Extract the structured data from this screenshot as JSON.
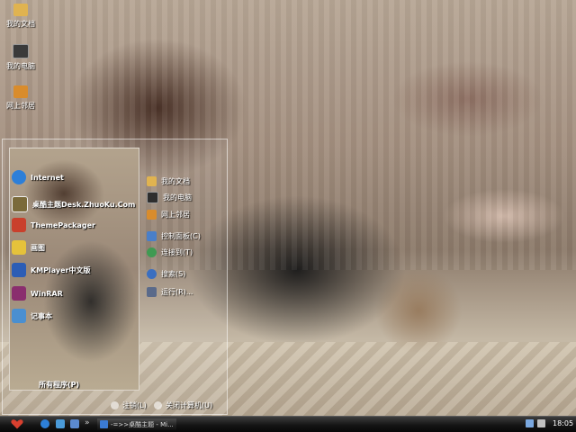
{
  "desktop": {
    "icons": [
      {
        "label": "我的文档",
        "icon": "folder-icon",
        "color": "#e0b350"
      },
      {
        "label": "我的电脑",
        "icon": "computer-icon",
        "color": "#3a3a3a"
      },
      {
        "label": "网上邻居",
        "icon": "network-icon",
        "color": "#d98c2c"
      }
    ]
  },
  "start_menu": {
    "programs": [
      {
        "label": "Internet",
        "icon": "internet-explorer-icon",
        "color": "#2d7fd8"
      },
      {
        "label": "桌酷主题Desk.ZhuoKu.Com",
        "icon": "zhuoku-theme-icon",
        "color": "#7a6a3a"
      },
      {
        "label": "ThemePackager",
        "icon": "theme-packager-icon",
        "color": "#c9402c"
      },
      {
        "label": "画图",
        "icon": "paint-icon",
        "color": "#e5c23b"
      },
      {
        "label": "KMPlayer中文版",
        "icon": "kmplayer-icon",
        "color": "#2c5db5"
      },
      {
        "label": "WinRAR",
        "icon": "winrar-icon",
        "color": "#8a2e6e"
      },
      {
        "label": "记事本",
        "icon": "notepad-icon",
        "color": "#4a8fd0"
      }
    ],
    "places": [
      {
        "label": "我的文档",
        "icon": "folder-icon",
        "color": "#e0b350"
      },
      {
        "label": "我的电脑",
        "icon": "computer-icon",
        "color": "#2e2e2e"
      },
      {
        "label": "网上邻居",
        "icon": "network-icon",
        "color": "#d98c2c"
      },
      {
        "label": "控制面板(C)",
        "icon": "control-panel-icon",
        "color": "#4a7fc9"
      },
      {
        "label": "连接到(T)",
        "icon": "connect-icon",
        "color": "#3f9a52"
      },
      {
        "label": "搜索(S)",
        "icon": "search-icon",
        "color": "#3b6fc0"
      },
      {
        "label": "运行(R)...",
        "icon": "run-icon",
        "color": "#5a6a8a"
      }
    ],
    "all_programs": "所有程序(P)",
    "logoff": "注销(L)",
    "shutdown": "关闭计算机(U)"
  },
  "taskbar": {
    "start_icon": "heart-start-icon",
    "start_color": "#d9402f",
    "quick_launch": [
      {
        "icon": "ie-quicklaunch-icon",
        "color": "#2d7fd8"
      },
      {
        "icon": "media-quicklaunch-icon",
        "color": "#4a9ad8"
      },
      {
        "icon": "show-desktop-icon",
        "color": "#5b8ad0"
      }
    ],
    "expand_arrow": "»",
    "window_title": "-=>>桌酷主题 - Mi...",
    "tray": [
      {
        "icon": "tray-network-icon",
        "color": "#7aa8e0"
      },
      {
        "icon": "tray-volume-icon",
        "color": "#c0c0c0"
      }
    ],
    "clock": "18:05"
  }
}
